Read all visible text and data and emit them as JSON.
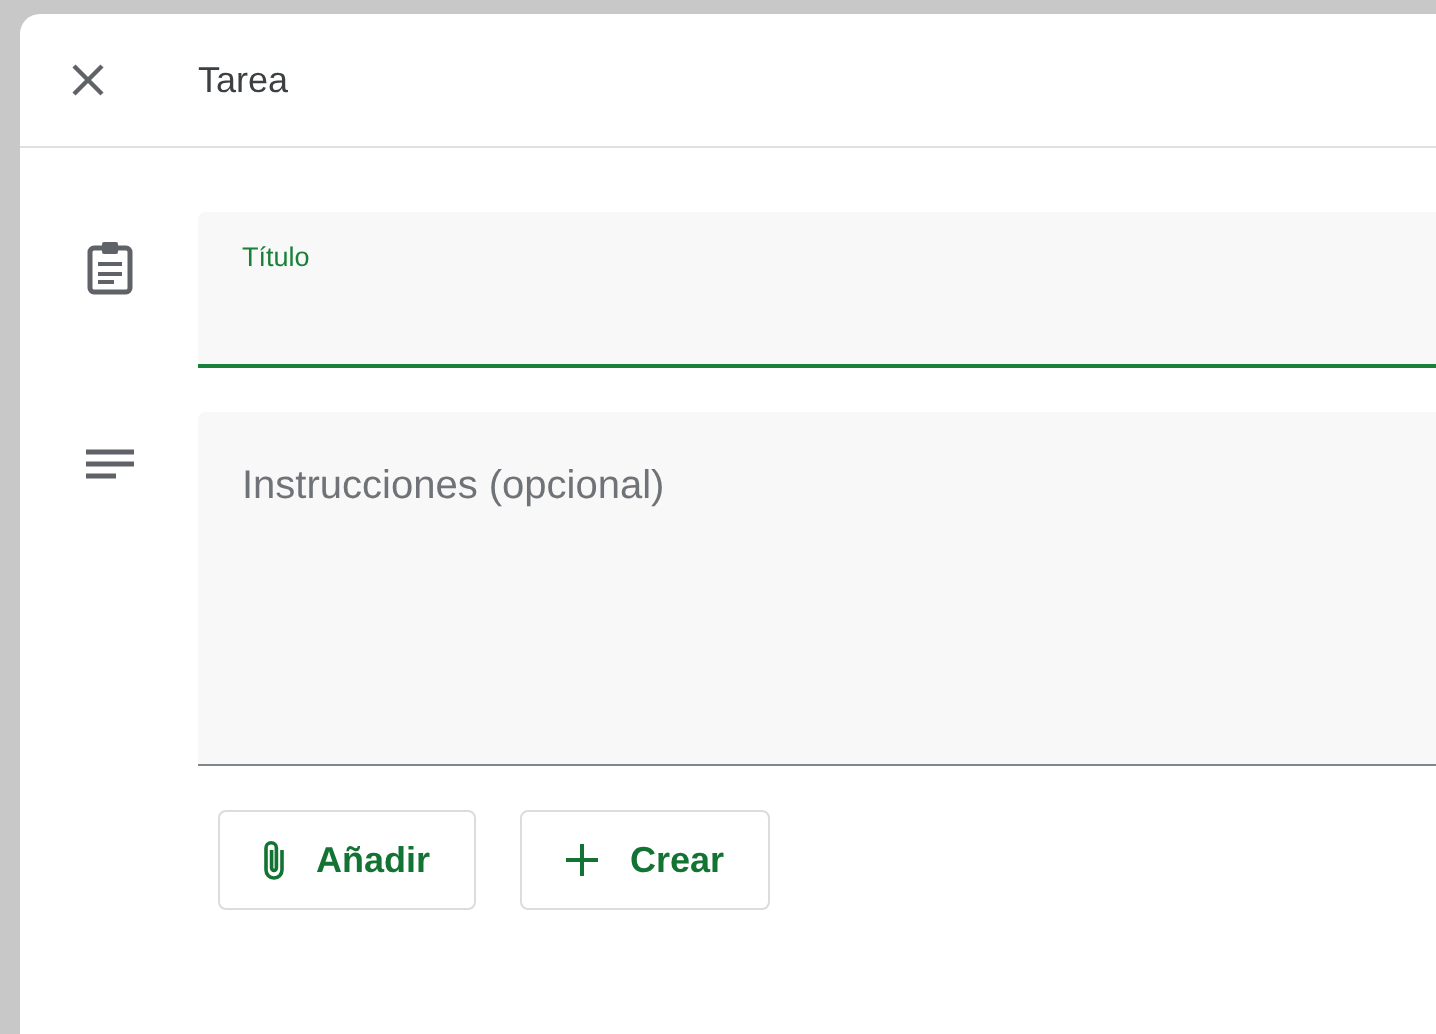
{
  "header": {
    "title": "Tarea"
  },
  "title_field": {
    "label": "Título",
    "focused": true
  },
  "instructions_field": {
    "placeholder": "Instrucciones (opcional)"
  },
  "buttons": [
    {
      "kind": "attach",
      "label": "Añadir"
    },
    {
      "kind": "create",
      "label": "Crear"
    }
  ]
}
